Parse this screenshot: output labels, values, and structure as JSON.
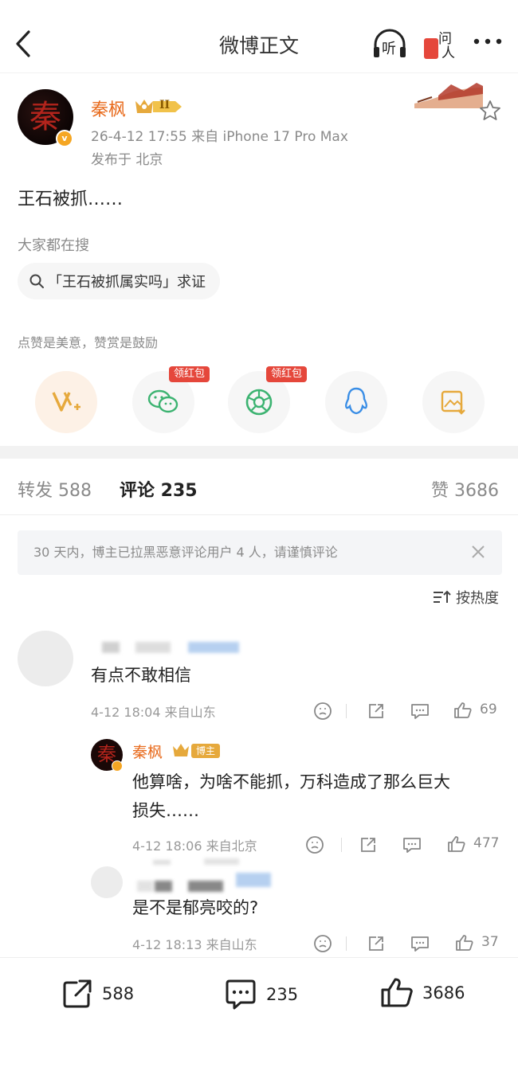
{
  "header": {
    "title": "微博正文",
    "listen_label": "听",
    "ask_label": "问",
    "ask_sub": "人"
  },
  "post": {
    "author": "秦枫",
    "avatar_seal": "秦",
    "vip_level": "II",
    "meta_line": "26-4-12 17:55  来自 iPhone 17 Pro Max",
    "location": "发布于 北京",
    "text": "王石被抓……"
  },
  "hot_search": {
    "title": "大家都在搜",
    "query": "「王石被抓属实吗」求证"
  },
  "reward_tip": "点赞是美意，赞赏是鼓励",
  "share_buttons": [
    {
      "name": "v-plus",
      "icon": "v-plus-icon",
      "tag": ""
    },
    {
      "name": "wechat",
      "icon": "wechat-icon",
      "tag": "领红包"
    },
    {
      "name": "moments",
      "icon": "moments-icon",
      "tag": "领红包"
    },
    {
      "name": "qq",
      "icon": "qq-icon",
      "tag": ""
    },
    {
      "name": "save-image",
      "icon": "save-image-icon",
      "tag": ""
    }
  ],
  "tabs": {
    "repost": "转发 588",
    "comment": "评论 235",
    "like": "赞 3686"
  },
  "notice": "30 天内，博主已拉黑恶意评论用户 4 人，请谨慎评论",
  "sort_label": "按热度",
  "comments": [
    {
      "text": "有点不敢相信",
      "meta": "4-12 18:04  来自山东",
      "likes": "69"
    },
    {
      "author": "秦枫",
      "badge": "博主",
      "text_line1": "他算啥，为啥不能抓，万科造成了那么巨大",
      "text_line2": "损失……",
      "meta": "4-12 18:06  来自北京",
      "likes": "477"
    },
    {
      "text": "是不是郁亮咬的?",
      "meta": "4-12 18:13  来自山东",
      "likes": "37"
    }
  ],
  "bottom_bar": {
    "repost": "588",
    "comment": "235",
    "like": "3686"
  },
  "colors": {
    "author_orange": "#e86b1d",
    "red_tag": "#e5473b",
    "wechat_green": "#3cb371",
    "qq_blue": "#3a8ee6",
    "gold": "#e6a93c"
  }
}
